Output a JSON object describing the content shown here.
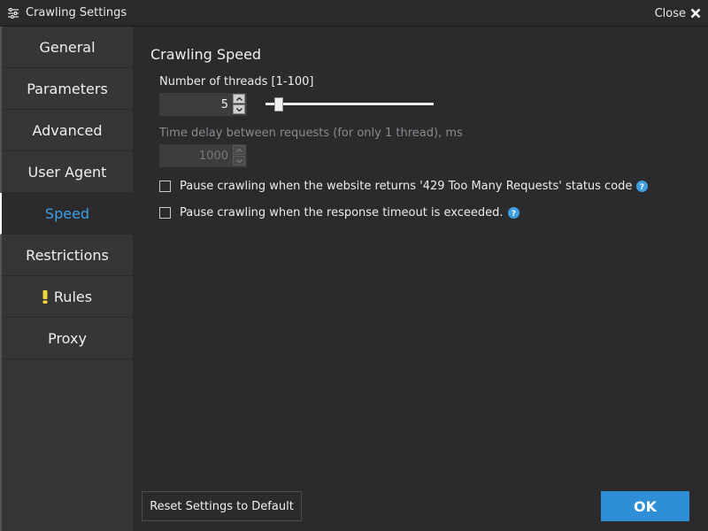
{
  "window": {
    "title": "Crawling Settings",
    "title_icon": "sliders-icon",
    "close_label": "Close",
    "close_icon": "close-x-icon"
  },
  "sidebar": {
    "items": [
      {
        "label": "General",
        "active": false
      },
      {
        "label": "Parameters",
        "active": false
      },
      {
        "label": "Advanced",
        "active": false
      },
      {
        "label": "User Agent",
        "active": false
      },
      {
        "label": "Speed",
        "active": true
      },
      {
        "label": "Restrictions",
        "active": false
      },
      {
        "label": "Rules",
        "active": false,
        "warning": true
      },
      {
        "label": "Proxy",
        "active": false
      }
    ]
  },
  "main": {
    "section_title": "Crawling Speed",
    "threads": {
      "label": "Number of threads [1-100]",
      "value": "5",
      "min": 1,
      "max": 100
    },
    "delay": {
      "label": "Time delay between requests (for only 1 thread), ms",
      "value": "1000",
      "disabled": true
    },
    "options": [
      {
        "label": "Pause crawling when the website returns '429 Too Many Requests' status code",
        "checked": false
      },
      {
        "label": "Pause crawling when the response timeout is exceeded.",
        "checked": false
      }
    ]
  },
  "footer": {
    "reset_label": "Reset Settings to Default",
    "ok_label": "OK"
  },
  "colors": {
    "accent": "#3d9ee0",
    "ok_button": "#2f8fd6",
    "background": "#2b2b2e",
    "sidebar": "#363639",
    "warning": "#f2d43d",
    "help": "#3d9ee0"
  }
}
